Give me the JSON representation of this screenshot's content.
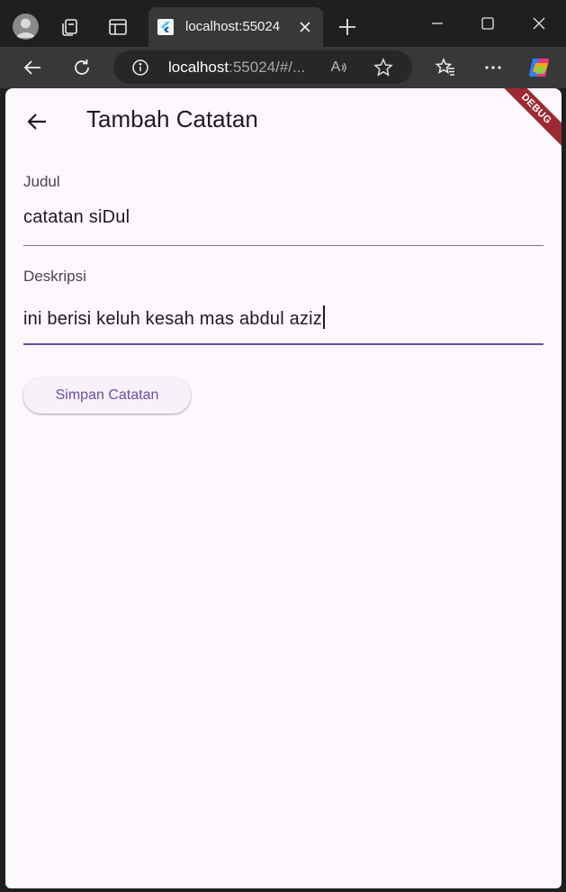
{
  "browser": {
    "tab": {
      "title": "localhost:55024",
      "favicon": "flutter-icon"
    },
    "address": {
      "host": "localhost",
      "rest": ":55024/#/..."
    },
    "icons": {
      "profile": "avatar-icon",
      "collections": "collections-icon",
      "vertical_tabs": "vertical-tabs-icon",
      "close_tab": "close-icon",
      "new_tab": "plus-icon",
      "minimize": "minimize-icon",
      "maximize": "maximize-icon",
      "close_window": "close-icon",
      "back": "arrow-left-icon",
      "refresh": "refresh-icon",
      "info": "info-icon",
      "read_aloud": "read-aloud-icon",
      "favorite": "star-icon",
      "favorites": "favorites-icon",
      "more": "more-icon",
      "copilot": "copilot-icon"
    },
    "read_aloud_label": "A"
  },
  "app": {
    "appbar": {
      "title": "Tambah Catatan",
      "back_icon": "arrow-left-icon"
    },
    "debug_banner": "DEBUG",
    "form": {
      "judul": {
        "label": "Judul",
        "value": "catatan siDul"
      },
      "deskripsi": {
        "label": "Deskripsi",
        "value": "ini berisi keluh kesah mas abdul aziz"
      }
    },
    "save_button": {
      "label": "Simpan Catatan"
    }
  },
  "colors": {
    "page_background": "#fdf7fe",
    "primary": "#6750a4",
    "text": "#1d1b20",
    "debug_ribbon": "#9b2a33",
    "browser_chrome": "#1f1f1f",
    "toolbar": "#383838"
  }
}
